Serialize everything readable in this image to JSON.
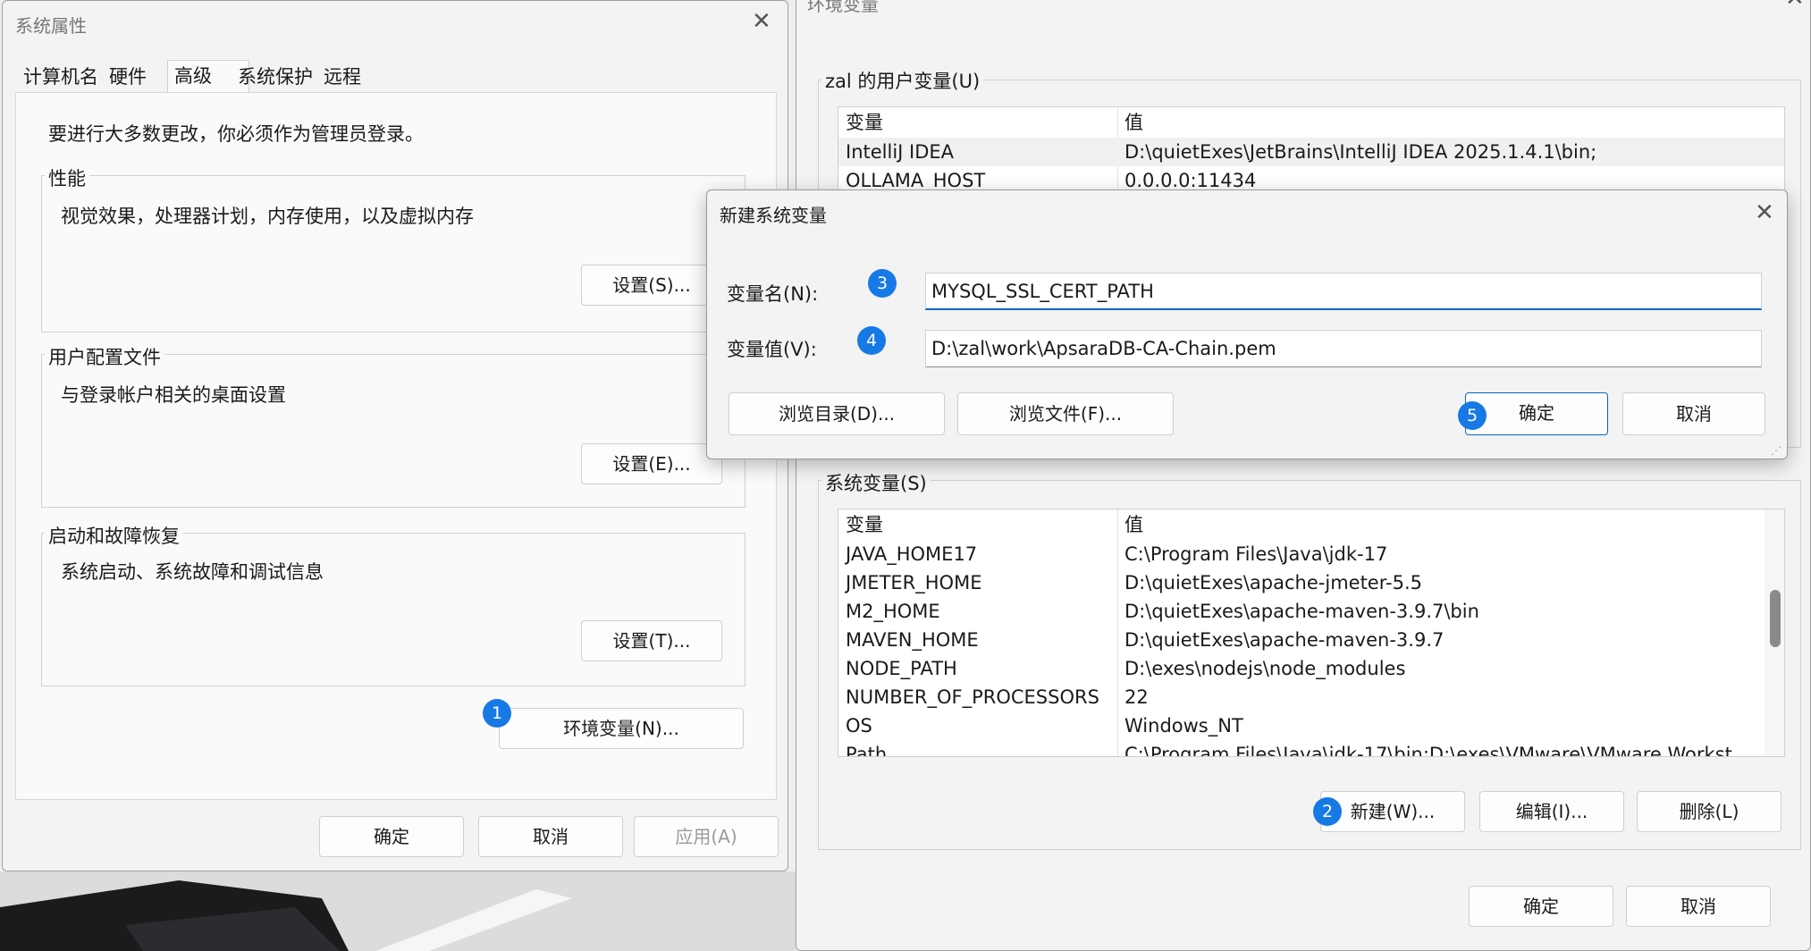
{
  "system_properties": {
    "title": "系统属性",
    "tabs": [
      "计算机名",
      "硬件",
      "高级",
      "系统保护",
      "远程"
    ],
    "admin_note": "要进行大多数更改，你必须作为管理员登录。",
    "performance": {
      "legend": "性能",
      "desc": "视觉效果，处理器计划，内存使用，以及虚拟内存",
      "button": "设置(S)..."
    },
    "user_profiles": {
      "legend": "用户配置文件",
      "desc": "与登录帐户相关的桌面设置",
      "button": "设置(E)..."
    },
    "startup_recovery": {
      "legend": "启动和故障恢复",
      "desc": "系统启动、系统故障和调试信息",
      "button": "设置(T)..."
    },
    "env_vars_button": "环境变量(N)...",
    "ok": "确定",
    "cancel": "取消",
    "apply": "应用(A)"
  },
  "env_vars": {
    "title": "环境变量",
    "user_section": "zal 的用户变量(U)",
    "col_var": "变量",
    "col_value": "值",
    "user_rows": [
      {
        "name": "IntelliJ IDEA",
        "value": "D:\\quietExes\\JetBrains\\IntelliJ IDEA 2025.1.4.1\\bin;"
      },
      {
        "name": "OLLAMA_HOST",
        "value": "0.0.0.0:11434"
      }
    ],
    "system_section": "系统变量(S)",
    "system_rows": [
      {
        "name": "JAVA_HOME17",
        "value": "C:\\Program Files\\Java\\jdk-17"
      },
      {
        "name": "JMETER_HOME",
        "value": "D:\\quietExes\\apache-jmeter-5.5"
      },
      {
        "name": "M2_HOME",
        "value": "D:\\quietExes\\apache-maven-3.9.7\\bin"
      },
      {
        "name": "MAVEN_HOME",
        "value": "D:\\quietExes\\apache-maven-3.9.7"
      },
      {
        "name": "NODE_PATH",
        "value": "D:\\exes\\nodejs\\node_modules"
      },
      {
        "name": "NUMBER_OF_PROCESSORS",
        "value": "22"
      },
      {
        "name": "OS",
        "value": "Windows_NT"
      },
      {
        "name": "Path",
        "value": "C:\\Program Files\\Java\\jdk-17\\bin;D:\\exes\\VMware\\VMware Workst..."
      }
    ],
    "new_button": "新建(W)...",
    "edit_button": "编辑(I)...",
    "delete_button": "删除(L)",
    "ok": "确定",
    "cancel": "取消"
  },
  "new_var_dialog": {
    "title": "新建系统变量",
    "name_label": "变量名(N):",
    "value_label": "变量值(V):",
    "name_value": "MYSQL_SSL_CERT_PATH",
    "value_value": "D:\\zal\\work\\ApsaraDB-CA-Chain.pem",
    "browse_dir": "浏览目录(D)...",
    "browse_file": "浏览文件(F)...",
    "ok": "确定",
    "cancel": "取消"
  },
  "step_badges": [
    "1",
    "2",
    "3",
    "4",
    "5"
  ]
}
